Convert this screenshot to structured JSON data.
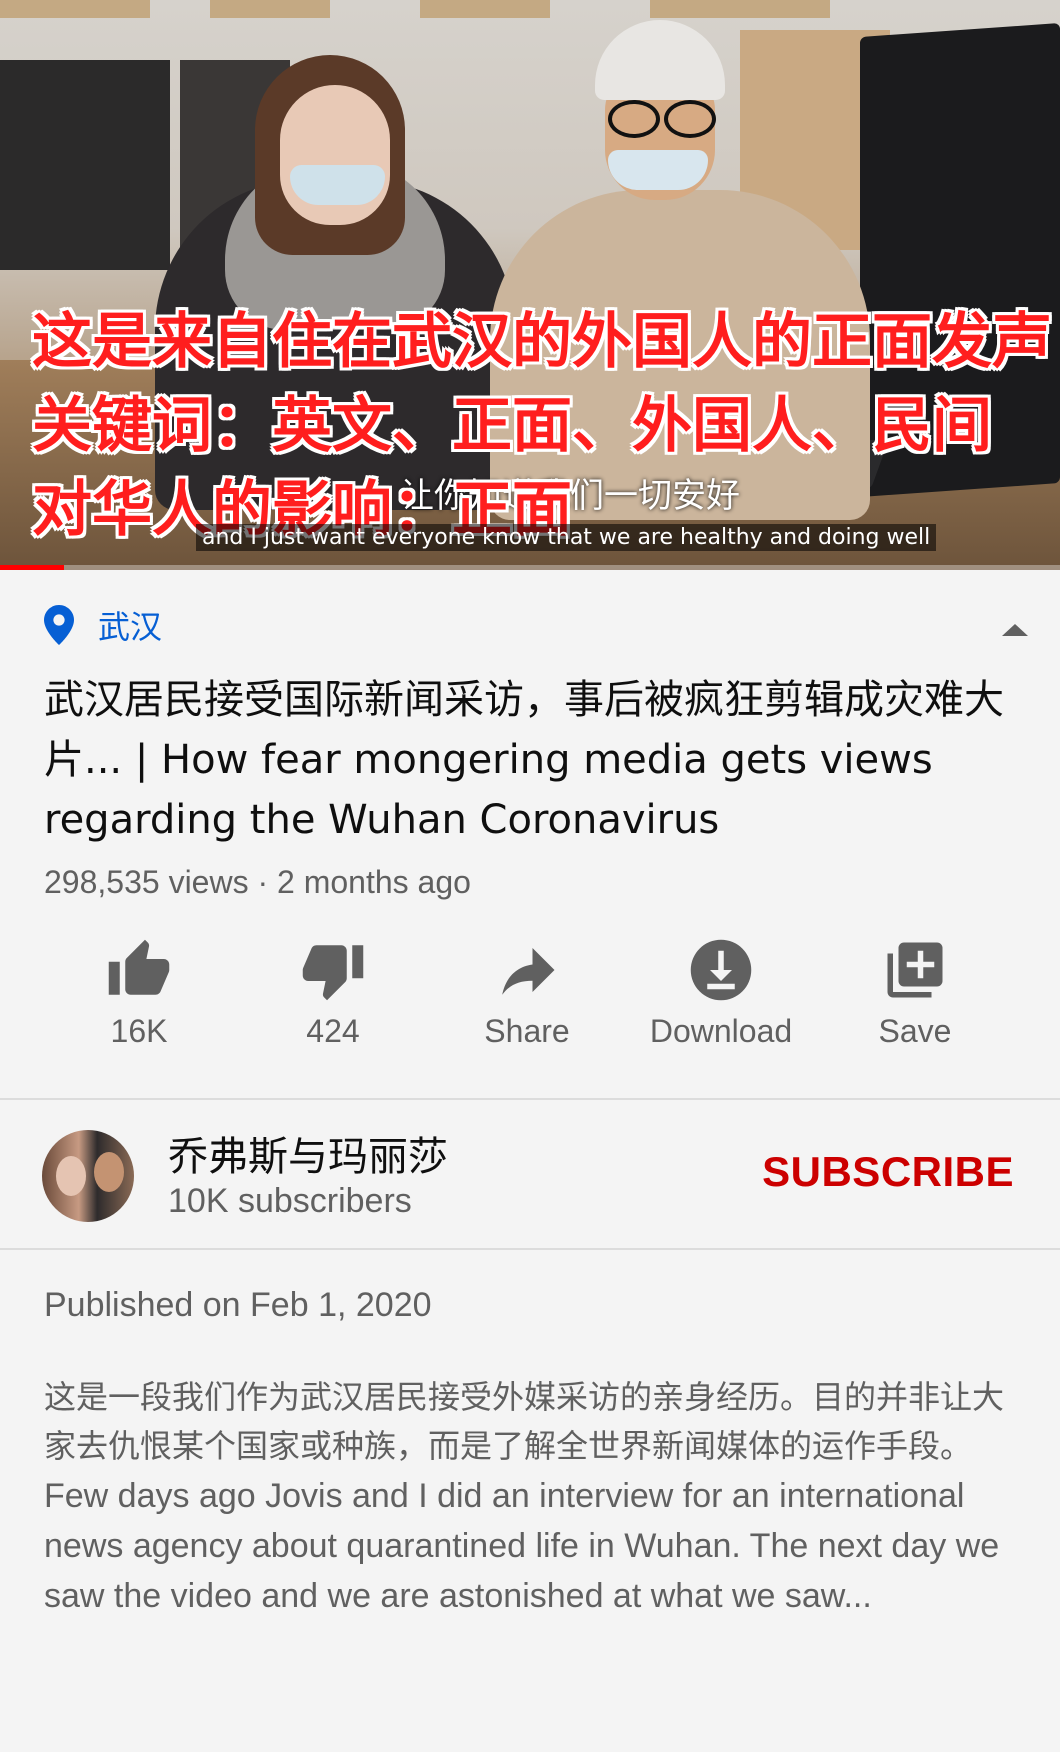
{
  "video": {
    "overlay_lines": [
      "这是来自住在武汉的外国人的正面发声",
      "关键词：英文、正面、外国人、民间",
      "对华人的影响：正面"
    ],
    "subtitle_cn": "让你知道我们一切安好",
    "subtitle_en": "and I just want everyone know that we are healthy and doing well",
    "progress": 0.06
  },
  "location": {
    "label": "武汉",
    "icon": "location-pin-icon"
  },
  "title": "武汉居民接受国际新闻采访，事后被疯狂剪辑成灾难大片... | How fear mongering media gets views regarding the Wuhan Coronavirus",
  "meta": "298,535 views · 2 months ago",
  "actions": [
    {
      "name": "like",
      "label": "16K",
      "icon": "thumbs-up-icon"
    },
    {
      "name": "dislike",
      "label": "424",
      "icon": "thumbs-down-icon"
    },
    {
      "name": "share",
      "label": "Share",
      "icon": "share-icon"
    },
    {
      "name": "download",
      "label": "Download",
      "icon": "download-icon"
    },
    {
      "name": "save",
      "label": "Save",
      "icon": "playlist-add-icon"
    }
  ],
  "channel": {
    "name": "乔弗斯与玛丽莎",
    "subscribers": "10K subscribers",
    "subscribe_label": "SUBSCRIBE"
  },
  "description": {
    "published": "Published on Feb 1, 2020",
    "cn": "这是一段我们作为武汉居民接受外媒采访的亲身经历。目的并非让大家去仇恨某个国家或种族，而是了解全世界新闻媒体的运作手段。",
    "en": "Few days ago Jovis and I did an interview for an international news agency about quarantined life in Wuhan. The next day we saw the video and we are astonished at what we saw..."
  },
  "colors": {
    "accent_link": "#065fd4",
    "subscribe": "#cc0000",
    "progress": "#ff0000",
    "overlay_text": "#ff1e1e",
    "background": "#f4f4f4"
  }
}
